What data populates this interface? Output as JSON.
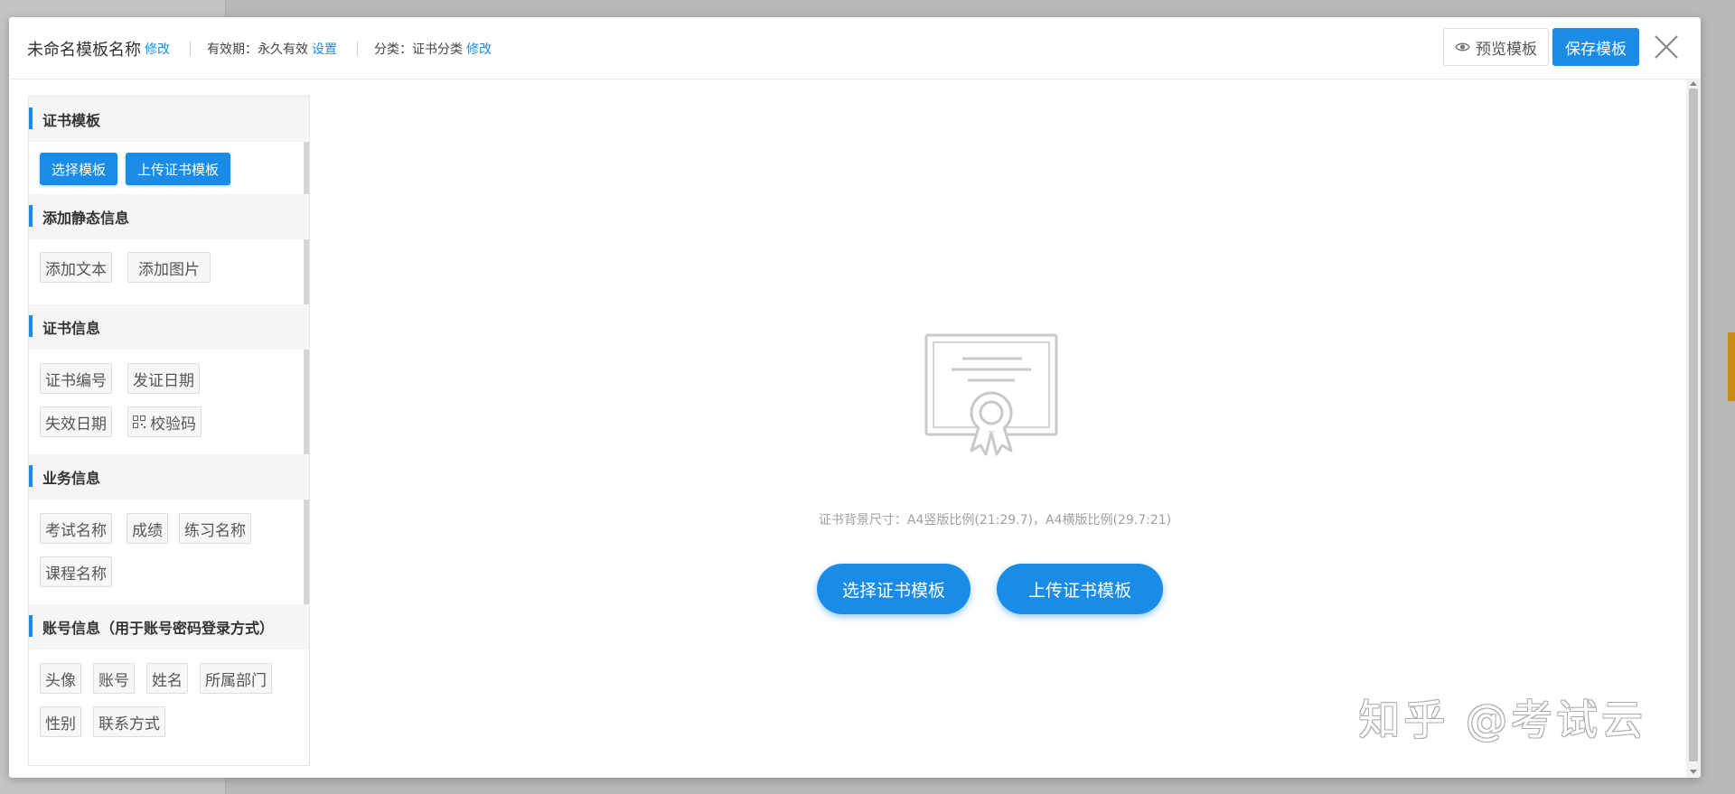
{
  "header": {
    "template_name": "未命名模板名称",
    "name_edit_link": "修改",
    "validity_label": "有效期：永久有效",
    "validity_link": "设置",
    "category_label": "分类：证书分类",
    "category_link": "修改",
    "preview_button": "预览模板",
    "save_button": "保存模板"
  },
  "sidebar": {
    "template_section": {
      "title": "证书模板",
      "buttons": [
        "选择模板",
        "上传证书模板"
      ]
    },
    "static_section": {
      "title": "添加静态信息",
      "items": [
        "添加文本",
        "添加图片"
      ]
    },
    "cert_info_section": {
      "title": "证书信息",
      "items": [
        "证书编号",
        "发证日期",
        "失效日期",
        "校验码"
      ]
    },
    "business_section": {
      "title": "业务信息",
      "items": [
        "考试名称",
        "成绩",
        "练习名称",
        "课程名称"
      ]
    },
    "account_section": {
      "title": "账号信息（用于账号密码登录方式）",
      "items": [
        "头像",
        "账号",
        "姓名",
        "所属部门",
        "性别",
        "联系方式"
      ]
    }
  },
  "canvas": {
    "size_hint": "证书背景尺寸：A4竖版比例(21:29.7)，A4横版比例(29.7:21)",
    "select_button": "选择证书模板",
    "upload_button": "上传证书模板"
  },
  "watermark": "知乎 @考试云",
  "colors": {
    "accent": "#1a8ce8",
    "panel_header_bg": "#f4f5f7",
    "tag_border": "#dedede",
    "hint_text": "#a0a0a0"
  }
}
